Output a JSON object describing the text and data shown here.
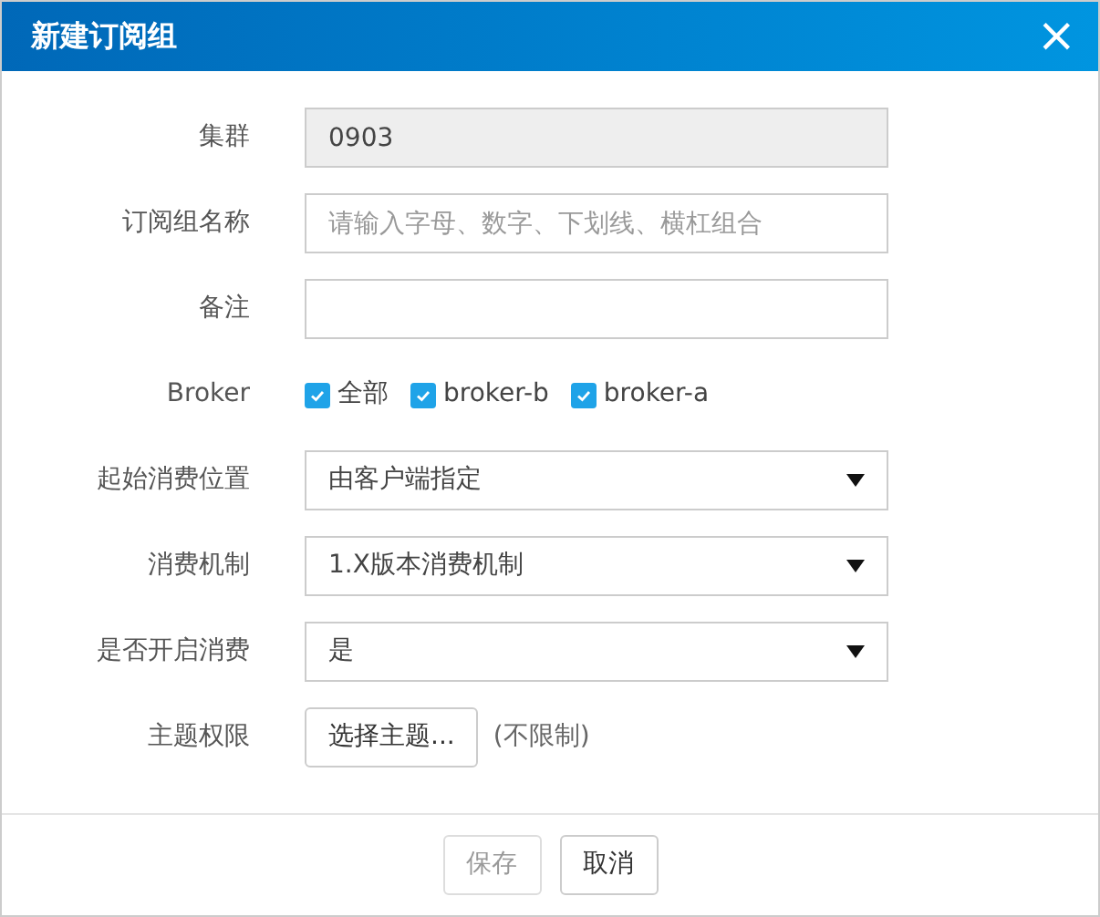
{
  "dialog": {
    "title": "新建订阅组",
    "close": "×"
  },
  "fields": [
    {
      "kind": "text",
      "label": "集群",
      "value": "0903",
      "disabled": true
    },
    {
      "kind": "text",
      "label": "订阅组名称",
      "placeholder": "请输入字母、数字、下划线、横杠组合",
      "disabled": false
    },
    {
      "kind": "text",
      "label": "备注",
      "disabled": false
    },
    {
      "kind": "checks",
      "label": "Broker",
      "options": [
        {
          "label": "全部",
          "checked": true
        },
        {
          "label": "broker-b",
          "checked": true
        },
        {
          "label": "broker-a",
          "checked": true
        }
      ]
    },
    {
      "kind": "select",
      "label": "起始消费位置",
      "value": "由客户端指定"
    },
    {
      "kind": "select",
      "label": "消费机制",
      "value": "1.X版本消费机制"
    },
    {
      "kind": "select",
      "label": "是否开启消费",
      "value": "是"
    },
    {
      "kind": "picker",
      "label": "主题权限",
      "button": "选择主题...",
      "note": "(不限制)"
    }
  ],
  "buttons": [
    {
      "label": "保存",
      "disabled": true
    },
    {
      "label": "取消",
      "disabled": false
    }
  ]
}
